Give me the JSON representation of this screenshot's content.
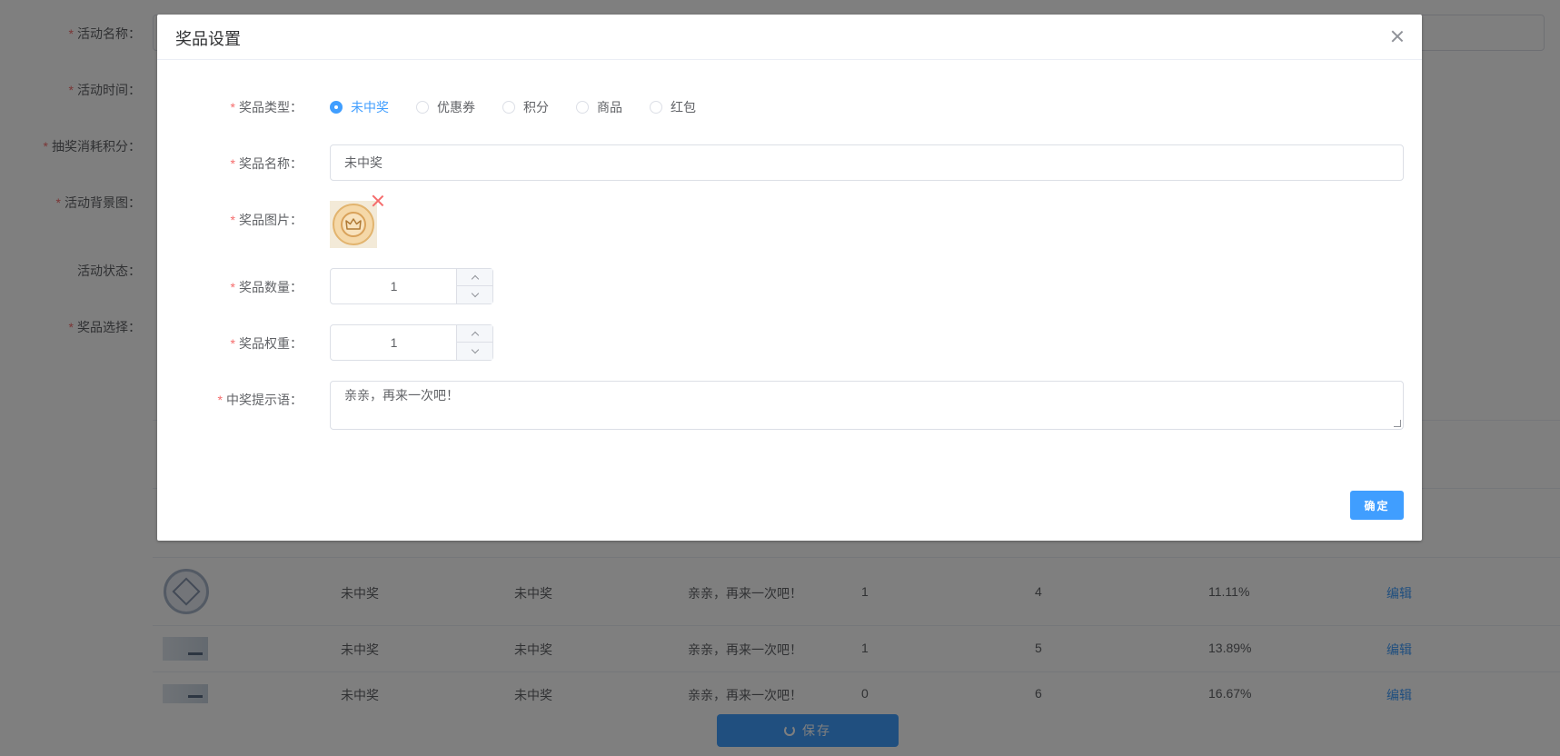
{
  "background": {
    "form_labels": {
      "activity_name": "活动名称：",
      "activity_time": "活动时间：",
      "lottery_points": "抽奖消耗积分：",
      "activity_bg": "活动背景图：",
      "activity_status": "活动状态：",
      "prize_select": "奖品选择："
    },
    "table_rows": [
      {
        "type": "未中奖",
        "name": "未中奖",
        "tip": "亲亲，再来一次吧！",
        "count": "1",
        "weight": "4",
        "rate": "11.11%",
        "action": "编辑"
      },
      {
        "type": "未中奖",
        "name": "未中奖",
        "tip": "亲亲，再来一次吧！",
        "count": "1",
        "weight": "5",
        "rate": "13.89%",
        "action": "编辑"
      },
      {
        "type": "未中奖",
        "name": "未中奖",
        "tip": "亲亲，再来一次吧！",
        "count": "0",
        "weight": "6",
        "rate": "16.67%",
        "action": "编辑"
      }
    ],
    "save_label": "保存"
  },
  "dialog": {
    "title": "奖品设置",
    "labels": {
      "prize_type": "奖品类型：",
      "prize_name": "奖品名称：",
      "prize_image": "奖品图片：",
      "prize_quantity": "奖品数量：",
      "prize_weight": "奖品权重：",
      "win_tip": "中奖提示语："
    },
    "prize_types": [
      "未中奖",
      "优惠券",
      "积分",
      "商品",
      "红包"
    ],
    "selected_type": "未中奖",
    "prize_name_value": "未中奖",
    "quantity": "1",
    "weight": "1",
    "win_tip_value": "亲亲，再来一次吧！",
    "confirm_label": "确定"
  },
  "colors": {
    "primary": "#409eff",
    "required": "#f56c6c"
  }
}
